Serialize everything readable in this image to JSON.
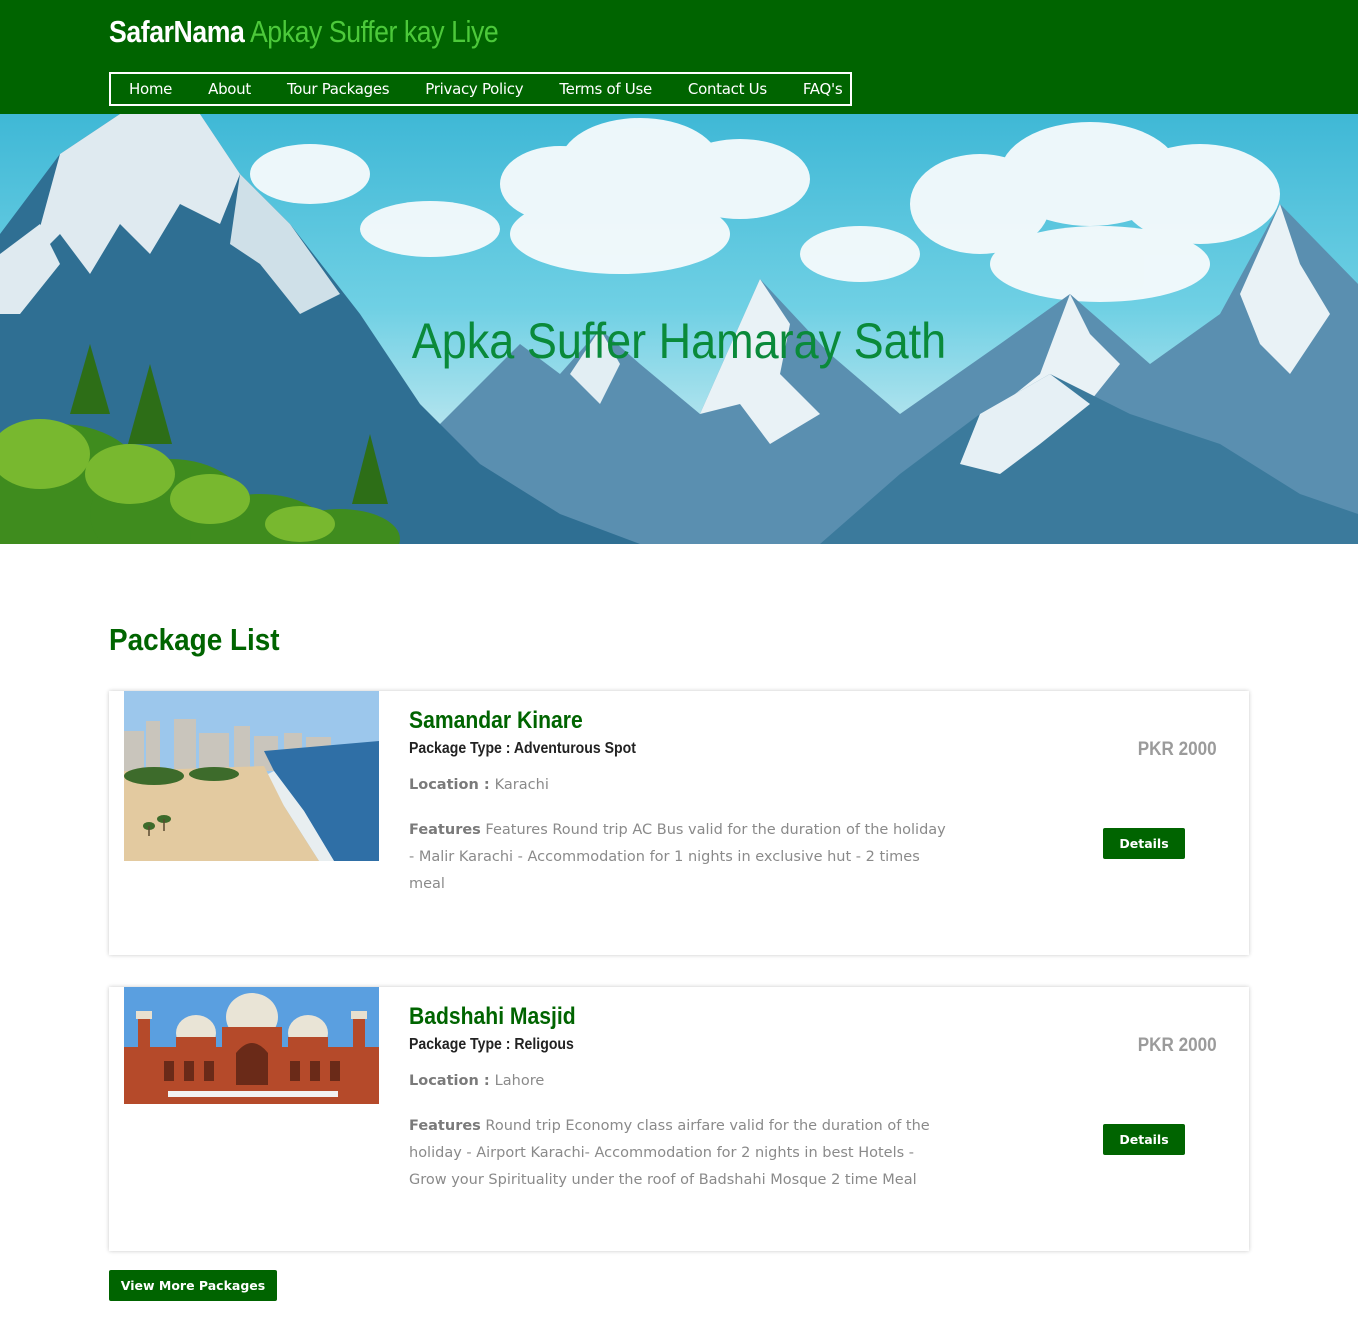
{
  "header": {
    "brand_main": "SafarNama",
    "brand_tagline": "Apkay Suffer kay Liye",
    "nav": [
      {
        "label": "Home"
      },
      {
        "label": "About"
      },
      {
        "label": "Tour Packages"
      },
      {
        "label": "Privacy Policy"
      },
      {
        "label": "Terms of Use"
      },
      {
        "label": "Contact Us"
      },
      {
        "label": "FAQ's"
      }
    ]
  },
  "hero": {
    "title": "Apka Suffer Hamaray Sath"
  },
  "main": {
    "section_title": "Package List",
    "packages": [
      {
        "name": "Samandar Kinare",
        "type_label": "Package Type : ",
        "type": "Adventurous Spot",
        "location_label": "Location : ",
        "location": "Karachi",
        "features_label": "Features",
        "features": " Features Round trip AC Bus valid for the duration of the holiday - Malir Karachi - Accommodation for 1 nights in exclusive hut - 2 times meal",
        "price": "PKR 2000",
        "button": "Details"
      },
      {
        "name": "Badshahi Masjid",
        "type_label": "Package Type : ",
        "type": "Religous",
        "location_label": "Location : ",
        "location": "Lahore",
        "features_label": "Features",
        "features": " Round trip Economy class airfare valid for the duration of the holiday - Airport Karachi- Accommodation for 2 nights in best Hotels - Grow your Spirituality under the roof of Badshahi Mosque 2 time Meal",
        "price": "PKR 2000",
        "button": "Details"
      }
    ],
    "more_button": "View More Packages"
  },
  "colors": {
    "primary_green": "#006400",
    "tagline_green": "#4cc93a",
    "hero_title": "#0a8a3a",
    "muted_text": "#8a8a8a"
  }
}
